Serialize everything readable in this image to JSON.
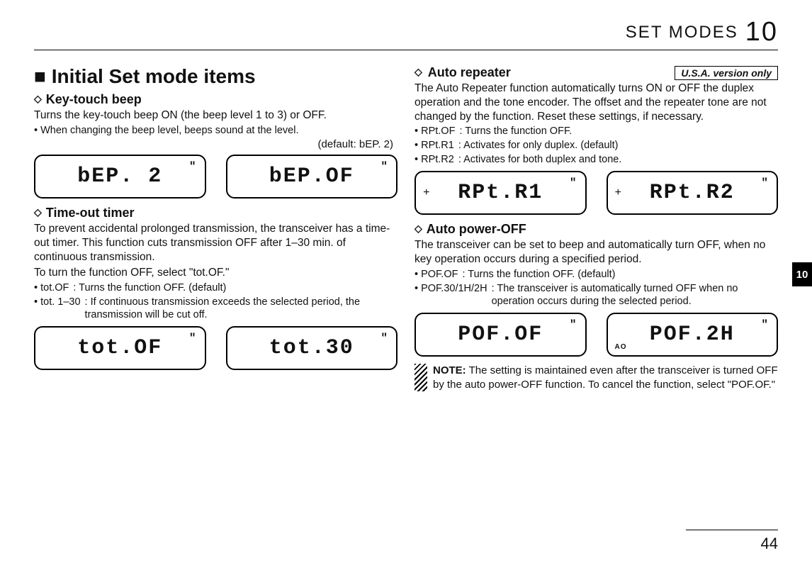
{
  "header": {
    "section_label": "SET MODES",
    "chapter_number": "10"
  },
  "side_tab": "10",
  "page_number": "44",
  "main_title": "■ Initial Set mode items",
  "left": {
    "key_beep": {
      "heading_prefix": "◇",
      "heading": "Key-touch beep",
      "p1": "Turns the key-touch beep ON (the beep level 1 to 3) or OFF.",
      "p2": "• When changing the beep level, beeps sound at the level.",
      "default": "(default: bEP. 2)",
      "lcd1": "bEP. 2",
      "lcd2": "bEP.OF"
    },
    "timeout": {
      "heading_prefix": "◇",
      "heading": "Time-out timer",
      "p1": "To prevent accidental prolonged transmission, the transceiver has a time-out timer. This function cuts transmission OFF after 1–30 min. of continuous transmission.",
      "p2": "To turn the function OFF, select \"tot.OF.\"",
      "b1_k": "• tot.OF",
      "b1_v": ": Turns the function OFF. (default)",
      "b2_k": "• tot. 1–30",
      "b2_v": ": If continuous transmission exceeds the selected period, the transmission will be cut off.",
      "lcd1": "tot.OF",
      "lcd2": "tot.30"
    }
  },
  "right": {
    "auto_rpt": {
      "heading_prefix": "◇",
      "heading": "Auto repeater",
      "badge": "U.S.A. version only",
      "p1": "The Auto Repeater function automatically turns ON or OFF the duplex operation and the tone encoder. The offset and the repeater tone are not changed by the function. Reset these settings, if necessary.",
      "b1_k": "• RPt.OF",
      "b1_v": ": Turns the function OFF.",
      "b2_k": "• RPt.R1",
      "b2_v": ": Activates for only duplex. (default)",
      "b3_k": "• RPt.R2",
      "b3_v": ": Activates for both duplex and tone.",
      "lcd1": "RPt.R1",
      "lcd2": "RPt.R2"
    },
    "auto_off": {
      "heading_prefix": "◇",
      "heading": "Auto power-OFF",
      "p1": "The transceiver can be set to beep and automatically turn OFF,  when no key operation occurs during a specified period.",
      "b1_k": "• POF.OF",
      "b1_v": ": Turns the function OFF. (default)",
      "b2_k": "• POF.30/1H/2H",
      "b2_v": ": The transceiver is automatically turned OFF when no operation occurs during the selected period.",
      "lcd1": "POF.OF",
      "lcd2": "POF.2H",
      "ao_label": "AO",
      "note_label": "NOTE:",
      "note_text": " The setting is maintained even after the transceiver is turned OFF by the auto power-OFF function. To cancel the function, select \"POF.OF.\""
    }
  }
}
